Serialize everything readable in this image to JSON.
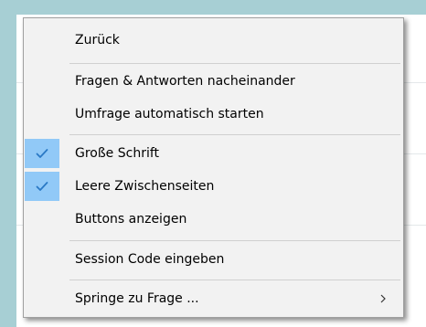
{
  "menu": {
    "items": [
      {
        "label": "Zurück",
        "checked": false
      },
      {
        "label": "Fragen & Antworten nacheinander",
        "checked": false
      },
      {
        "label": "Umfrage automatisch starten",
        "checked": false
      },
      {
        "label": "Große Schrift",
        "checked": true
      },
      {
        "label": "Leere Zwischenseiten",
        "checked": true
      },
      {
        "label": "Buttons anzeigen",
        "checked": false
      },
      {
        "label": "Session Code eingeben",
        "checked": false
      },
      {
        "label": "Springe zu Frage ...",
        "checked": false,
        "has_submenu": true
      }
    ]
  },
  "colors": {
    "check_highlight": "#91c9f7",
    "check_mark": "#2a79c5",
    "background": "#a7cfd4"
  },
  "icons": {
    "check": "checkmark-icon",
    "submenu": "chevron-right-icon"
  }
}
